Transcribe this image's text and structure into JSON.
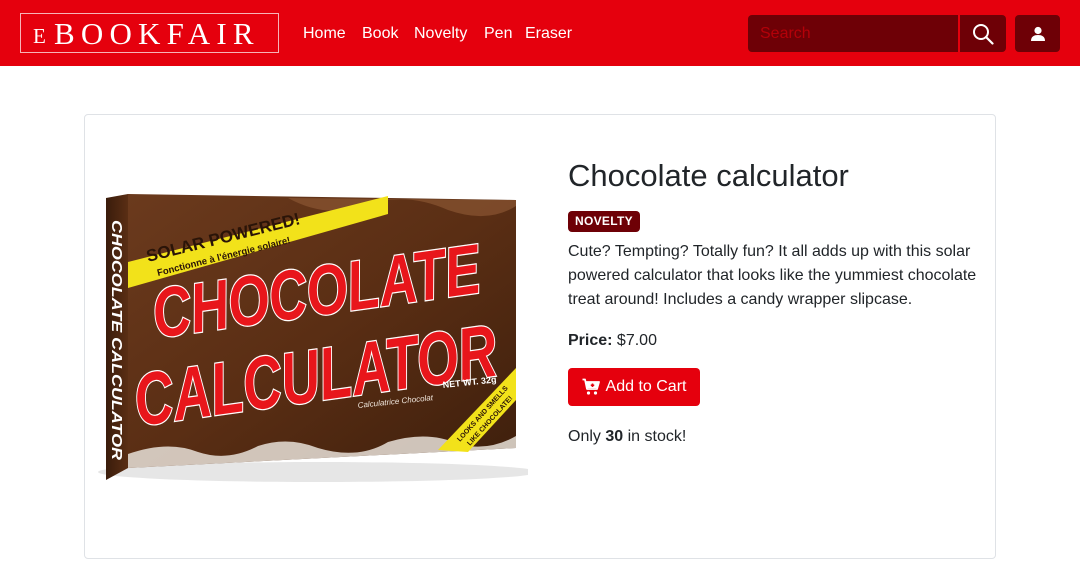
{
  "brand": {
    "small": "E",
    "big": "BOOKFAIR"
  },
  "nav": {
    "items": [
      {
        "label": "Home"
      },
      {
        "label": "Book"
      },
      {
        "label": "Novelty"
      },
      {
        "label": "Pen"
      },
      {
        "label": "Eraser"
      }
    ]
  },
  "search": {
    "placeholder": "Search",
    "icon": "search-icon"
  },
  "user": {
    "icon": "user-icon"
  },
  "product": {
    "title": "Chocolate calculator",
    "badge": "NOVELTY",
    "description": "Cute? Tempting? Totally fun? It all adds up with this solar powered calculator that looks like the yummiest chocolate treat around! Includes a candy wrapper slipcase.",
    "price_label": "Price:",
    "price_value": "$7.00",
    "cart_label": "Add to Cart",
    "stock_prefix": "Only",
    "stock_count": "30",
    "stock_suffix": "in stock!",
    "image": {
      "banner_line1": "SOLAR POWERED!",
      "banner_line2": "Fonctionne à l'énergie solaire!",
      "word1": "CHOCOLATE",
      "word2": "CALCULATOR",
      "side": "CHOCOLATE CALCULATOR",
      "subtitle": "Calculatrice Chocolat",
      "weight": "NET WT. 32g",
      "corner_line1": "LOOKS AND SMELLS",
      "corner_line2": "LIKE CHOCOLATE!"
    }
  },
  "colors": {
    "brand_red": "#e5000d",
    "dark_red": "#6e0006",
    "border": "#dfe2e6"
  }
}
